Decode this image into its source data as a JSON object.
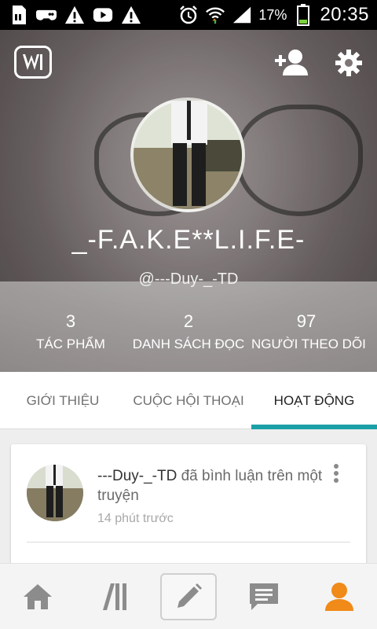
{
  "status_bar": {
    "battery_percent": "17%",
    "time": "20:35",
    "left_icons": [
      "sd-card-icon",
      "gamepad-icon",
      "warning-icon",
      "youtube-icon",
      "warning-icon"
    ],
    "right_icons": [
      "alarm-icon",
      "wifi-icon",
      "signal-icon",
      "battery-icon"
    ]
  },
  "header": {
    "app_icon": "wattpad-logo-icon",
    "add_user_icon": "add-person-icon",
    "settings_icon": "gear-icon",
    "display_name": "_-F.A.K.E**L.I.F.E-",
    "username": "@---Duy-_-TD"
  },
  "stats": [
    {
      "value": "3",
      "label": "TÁC PHẨM"
    },
    {
      "value": "2",
      "label": "DANH SÁCH ĐỌC"
    },
    {
      "value": "97",
      "label": "NGƯỜI THEO DÕI"
    }
  ],
  "tabs": [
    {
      "label": "GIỚI THIỆU",
      "active": false
    },
    {
      "label": "CUỘC HỘI THOẠI",
      "active": false
    },
    {
      "label": "HOẠT ĐỘNG",
      "active": true
    }
  ],
  "activity": {
    "author": "---Duy-_-TD",
    "action": "đã bình luận trên một truyện",
    "time": "14 phút trước"
  },
  "bottom_nav": [
    "home-icon",
    "library-icon",
    "write-icon",
    "messages-icon",
    "profile-icon"
  ],
  "colors": {
    "accent": "#1aa0a6",
    "active_nav": "#f08a19",
    "inactive_nav": "#8c8c8c"
  }
}
